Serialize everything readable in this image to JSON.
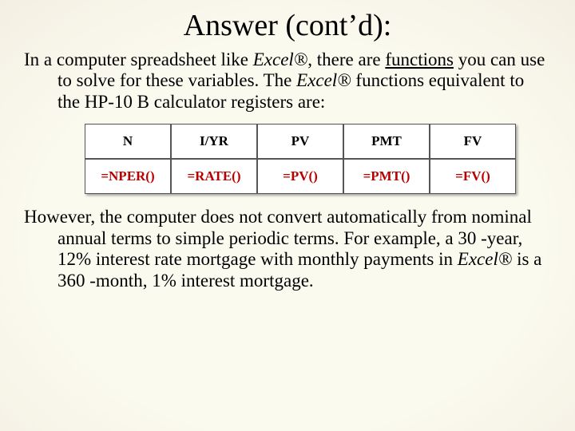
{
  "title": "Answer (cont’d):",
  "p1_a": "In a computer spreadsheet like ",
  "p1_b": "Excel®",
  "p1_c": ", there are ",
  "p1_d": "functions",
  "p1_e": " you can use to solve for these variables. The ",
  "p1_f": "Excel®",
  "p1_g": " functions equivalent to the HP-10 B calculator registers are:",
  "table": {
    "h0": "N",
    "h1": "I/YR",
    "h2": "PV",
    "h3": "PMT",
    "h4": "FV",
    "r0": "=NPER()",
    "r1": "=RATE()",
    "r2": "=PV()",
    "r3": "=PMT()",
    "r4": "=FV()"
  },
  "p2_a": "However, the computer does not convert automatically from nominal annual terms to simple periodic terms. For example, a 30 -year, 12% interest rate mortgage with monthly payments in ",
  "p2_b": "Excel®",
  "p2_c": " is a 360 -month, 1% interest mortgage."
}
